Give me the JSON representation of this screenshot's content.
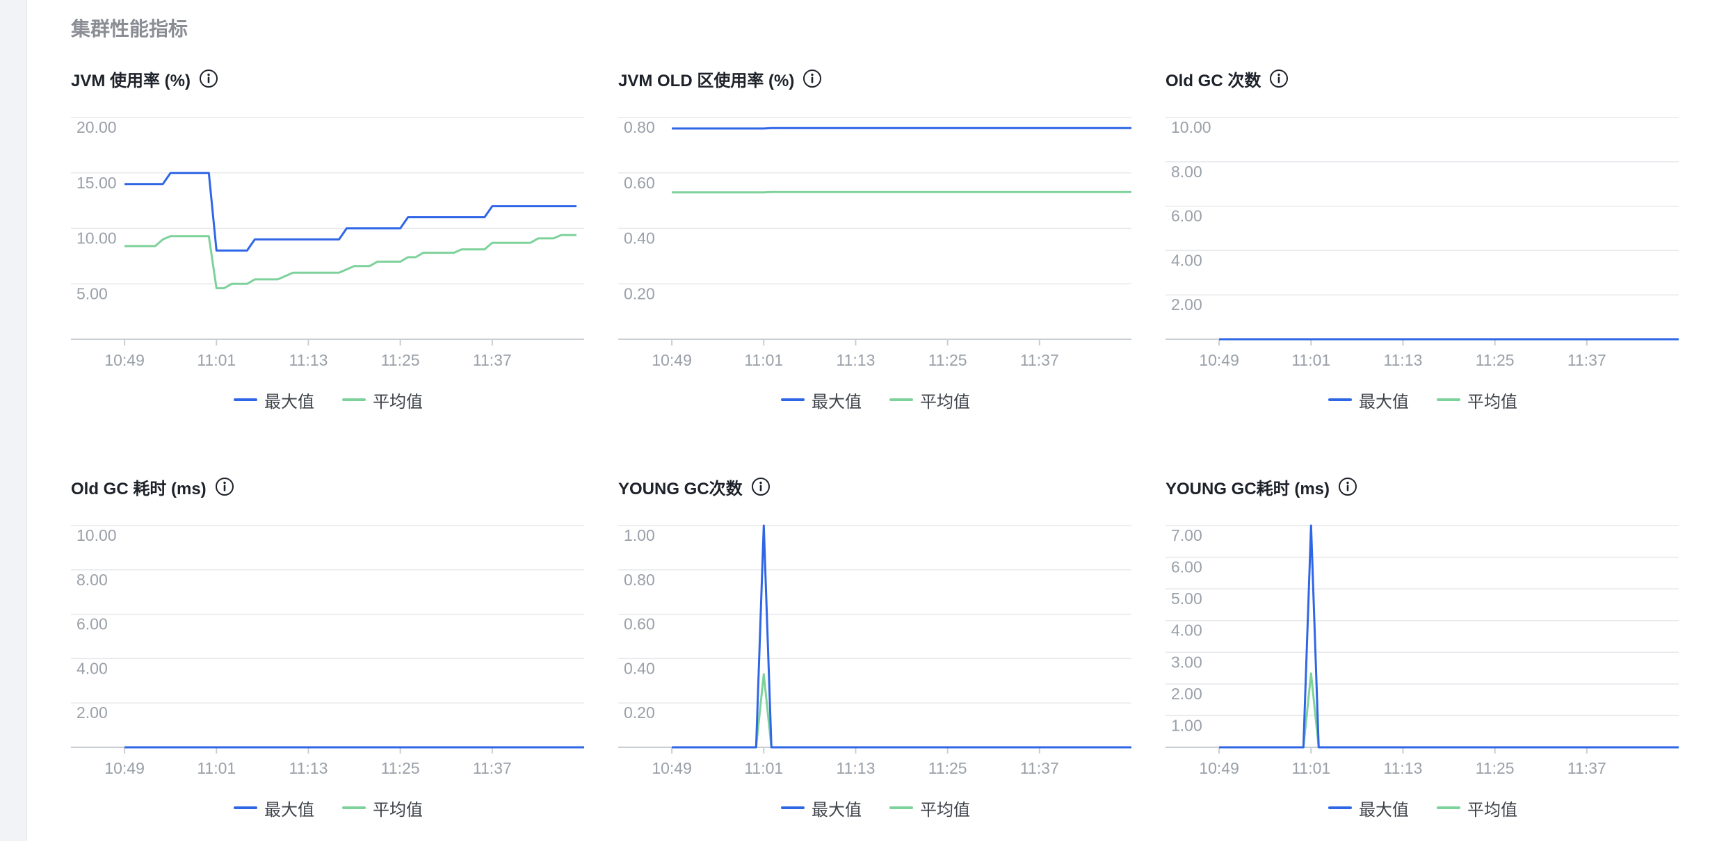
{
  "section_title": "集群性能指标",
  "colors": {
    "max": "#2f66e6",
    "avg": "#7dd19a",
    "grid": "#e6e8eb",
    "axis": "#c9cdd4"
  },
  "legend": {
    "max_label": "最大值",
    "avg_label": "平均值"
  },
  "icons": {
    "info": "info-circle-icon"
  },
  "chart_data": [
    {
      "type": "line",
      "title": "JVM 使用率 (%)",
      "x": [
        "10:49",
        "11:01",
        "11:13",
        "11:25",
        "11:37"
      ],
      "xlim": [
        -7,
        60
      ],
      "ylim": [
        0,
        20
      ],
      "yticks": [
        5,
        10,
        15,
        20
      ],
      "ytick_labels": [
        "5.00",
        "10.00",
        "15.00",
        "20.00"
      ],
      "grid": true,
      "legend": "bottom-center",
      "series": [
        {
          "name": "最大值",
          "points": [
            [
              0,
              14
            ],
            [
              5,
              14
            ],
            [
              6,
              15
            ],
            [
              11,
              15
            ],
            [
              12,
              8
            ],
            [
              16,
              8
            ],
            [
              17,
              9
            ],
            [
              28,
              9
            ],
            [
              29,
              10
            ],
            [
              36,
              10
            ],
            [
              37,
              11
            ],
            [
              47,
              11
            ],
            [
              48,
              12
            ],
            [
              59,
              12
            ]
          ]
        },
        {
          "name": "平均值",
          "points": [
            [
              0,
              8.4
            ],
            [
              4,
              8.4
            ],
            [
              5,
              9
            ],
            [
              6,
              9.3
            ],
            [
              11,
              9.3
            ],
            [
              12,
              4.6
            ],
            [
              13,
              4.6
            ],
            [
              14,
              5
            ],
            [
              16,
              5
            ],
            [
              17,
              5.4
            ],
            [
              20,
              5.4
            ],
            [
              22,
              6
            ],
            [
              28,
              6
            ],
            [
              30,
              6.6
            ],
            [
              32,
              6.6
            ],
            [
              33,
              7
            ],
            [
              36,
              7
            ],
            [
              37,
              7.4
            ],
            [
              38,
              7.4
            ],
            [
              39,
              7.8
            ],
            [
              43,
              7.8
            ],
            [
              44,
              8.1
            ],
            [
              47,
              8.1
            ],
            [
              48,
              8.7
            ],
            [
              53,
              8.7
            ],
            [
              54,
              9.1
            ],
            [
              56,
              9.1
            ],
            [
              57,
              9.4
            ],
            [
              59,
              9.4
            ]
          ]
        }
      ]
    },
    {
      "type": "line",
      "title": "JVM OLD 区使用率 (%)",
      "x": [
        "10:49",
        "11:01",
        "11:13",
        "11:25",
        "11:37"
      ],
      "xlim": [
        -7,
        60
      ],
      "ylim": [
        0,
        0.8
      ],
      "yticks": [
        0.2,
        0.4,
        0.6,
        0.8
      ],
      "ytick_labels": [
        "0.20",
        "0.40",
        "0.60",
        "0.80"
      ],
      "grid": true,
      "legend": "bottom-center",
      "series": [
        {
          "name": "最大值",
          "points": [
            [
              0,
              0.76
            ],
            [
              12,
              0.76
            ],
            [
              13,
              0.762
            ],
            [
              60,
              0.762
            ]
          ]
        },
        {
          "name": "平均值",
          "points": [
            [
              0,
              0.53
            ],
            [
              12,
              0.53
            ],
            [
              13,
              0.531
            ],
            [
              60,
              0.531
            ]
          ]
        }
      ]
    },
    {
      "type": "line",
      "title": "Old GC 次数",
      "x": [
        "10:49",
        "11:01",
        "11:13",
        "11:25",
        "11:37"
      ],
      "xlim": [
        -7,
        60
      ],
      "ylim": [
        0,
        10
      ],
      "yticks": [
        2,
        4,
        6,
        8,
        10
      ],
      "ytick_labels": [
        "2.00",
        "4.00",
        "6.00",
        "8.00",
        "10.00"
      ],
      "grid": true,
      "legend": "bottom-center",
      "series": [
        {
          "name": "最大值",
          "points": [
            [
              0,
              0
            ],
            [
              60,
              0
            ]
          ]
        },
        {
          "name": "平均值",
          "points": [
            [
              0,
              0
            ],
            [
              60,
              0
            ]
          ]
        }
      ]
    },
    {
      "type": "line",
      "title": "Old GC 耗时 (ms)",
      "x": [
        "10:49",
        "11:01",
        "11:13",
        "11:25",
        "11:37"
      ],
      "xlim": [
        -7,
        60
      ],
      "ylim": [
        0,
        10
      ],
      "yticks": [
        2,
        4,
        6,
        8,
        10
      ],
      "ytick_labels": [
        "2.00",
        "4.00",
        "6.00",
        "8.00",
        "10.00"
      ],
      "grid": true,
      "legend": "bottom-center",
      "series": [
        {
          "name": "最大值",
          "points": [
            [
              0,
              0
            ],
            [
              60,
              0
            ]
          ]
        },
        {
          "name": "平均值",
          "points": [
            [
              0,
              0
            ],
            [
              60,
              0
            ]
          ]
        }
      ]
    },
    {
      "type": "line",
      "title": "YOUNG GC次数",
      "x": [
        "10:49",
        "11:01",
        "11:13",
        "11:25",
        "11:37"
      ],
      "xlim": [
        -7,
        60
      ],
      "ylim": [
        0,
        1
      ],
      "yticks": [
        0.2,
        0.4,
        0.6,
        0.8,
        1.0
      ],
      "ytick_labels": [
        "0.20",
        "0.40",
        "0.60",
        "0.80",
        "1.00"
      ],
      "grid": true,
      "legend": "bottom-center",
      "series": [
        {
          "name": "最大值",
          "points": [
            [
              0,
              0
            ],
            [
              11,
              0
            ],
            [
              12,
              1
            ],
            [
              13,
              0
            ],
            [
              60,
              0
            ]
          ]
        },
        {
          "name": "平均值",
          "points": [
            [
              0,
              0
            ],
            [
              11,
              0
            ],
            [
              12,
              0.33
            ],
            [
              13,
              0
            ],
            [
              60,
              0
            ]
          ]
        }
      ]
    },
    {
      "type": "line",
      "title": "YOUNG GC耗时 (ms)",
      "x": [
        "10:49",
        "11:01",
        "11:13",
        "11:25",
        "11:37"
      ],
      "xlim": [
        -7,
        60
      ],
      "ylim": [
        0,
        7
      ],
      "yticks": [
        1,
        2,
        3,
        4,
        5,
        6,
        7
      ],
      "ytick_labels": [
        "1.00",
        "2.00",
        "3.00",
        "4.00",
        "5.00",
        "6.00",
        "7.00"
      ],
      "grid": true,
      "legend": "bottom-center",
      "series": [
        {
          "name": "最大值",
          "points": [
            [
              0,
              0
            ],
            [
              11,
              0
            ],
            [
              12,
              7
            ],
            [
              13,
              0
            ],
            [
              60,
              0
            ]
          ]
        },
        {
          "name": "平均值",
          "points": [
            [
              0,
              0
            ],
            [
              11,
              0
            ],
            [
              12,
              2.33
            ],
            [
              13,
              0
            ],
            [
              60,
              0
            ]
          ]
        }
      ]
    }
  ]
}
